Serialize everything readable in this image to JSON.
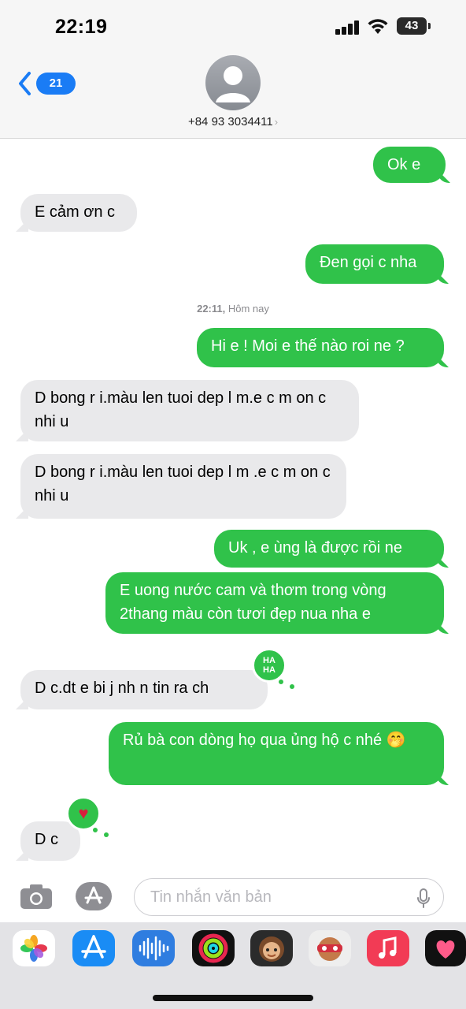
{
  "status_bar": {
    "time": "22:19",
    "battery": "43"
  },
  "header": {
    "back_badge": "21",
    "contact": "+84 93 3034411",
    "chevron": "›"
  },
  "timestamp": {
    "time": "22:11,",
    "day": "Hôm nay"
  },
  "messages": [
    {
      "side": "out",
      "text": "Ok e"
    },
    {
      "side": "in",
      "text": "E cảm ơn c"
    },
    {
      "side": "out",
      "text": "Đen gọi c nha"
    },
    {
      "side": "out",
      "text": "Hi e ! Moi e thế nào roi ne ?"
    },
    {
      "side": "in",
      "text": "D  bong r i.màu len tuoi dep l m.e c m on  c nhi u"
    },
    {
      "side": "in",
      "text": "D  bong r i.màu len tuoi dep l m  .e c m on c nhi u"
    },
    {
      "side": "out",
      "text": "Uk , e ùng là được rồi ne"
    },
    {
      "side": "out",
      "text": "E uong nước cam và thơm trong vòng 2thang màu còn tươi đẹp nua nha e"
    },
    {
      "side": "in",
      "text": "D  c.dt e bi j nh n tin ra ch"
    },
    {
      "side": "out",
      "text": "Rủ bà con dòng họ qua ủng hộ c nhé 🤭"
    },
    {
      "side": "in",
      "text": "D  c"
    }
  ],
  "tapbacks": {
    "haha_line1": "HA",
    "haha_line2": "HA",
    "heart": "♥"
  },
  "input": {
    "placeholder": "Tin nhắn văn bản"
  },
  "icons": [
    "camera-icon",
    "app-store-icon",
    "microphone-icon",
    "photos-icon",
    "app-store-icon",
    "audio-message-icon",
    "activity-icon",
    "memoji-icon",
    "memoji-sticker-icon",
    "music-icon",
    "heart-app-icon"
  ],
  "colors": {
    "outgoing_bubble": "#30c24a",
    "incoming_bubble": "#e9e9eb",
    "badge": "#1a7cf5"
  }
}
